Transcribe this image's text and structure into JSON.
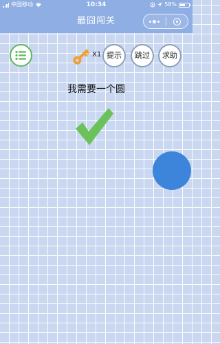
{
  "status_bar": {
    "carrier": "中国移动",
    "time": "10:34",
    "battery_percent": "58%",
    "battery_level": 0.58
  },
  "nav": {
    "title": "最囧闯关"
  },
  "toolbar": {
    "key_count": "X1",
    "hint_label": "提示",
    "skip_label": "跳过",
    "help_label": "求助"
  },
  "puzzle": {
    "text": "我需要一个圆"
  },
  "colors": {
    "background": "#c9d7f1",
    "nav": "#8faee3",
    "menu_green": "#5cb85c",
    "check_green": "#6cc25a",
    "key_orange": "#f0a030",
    "circle_blue": "#3d85da"
  }
}
